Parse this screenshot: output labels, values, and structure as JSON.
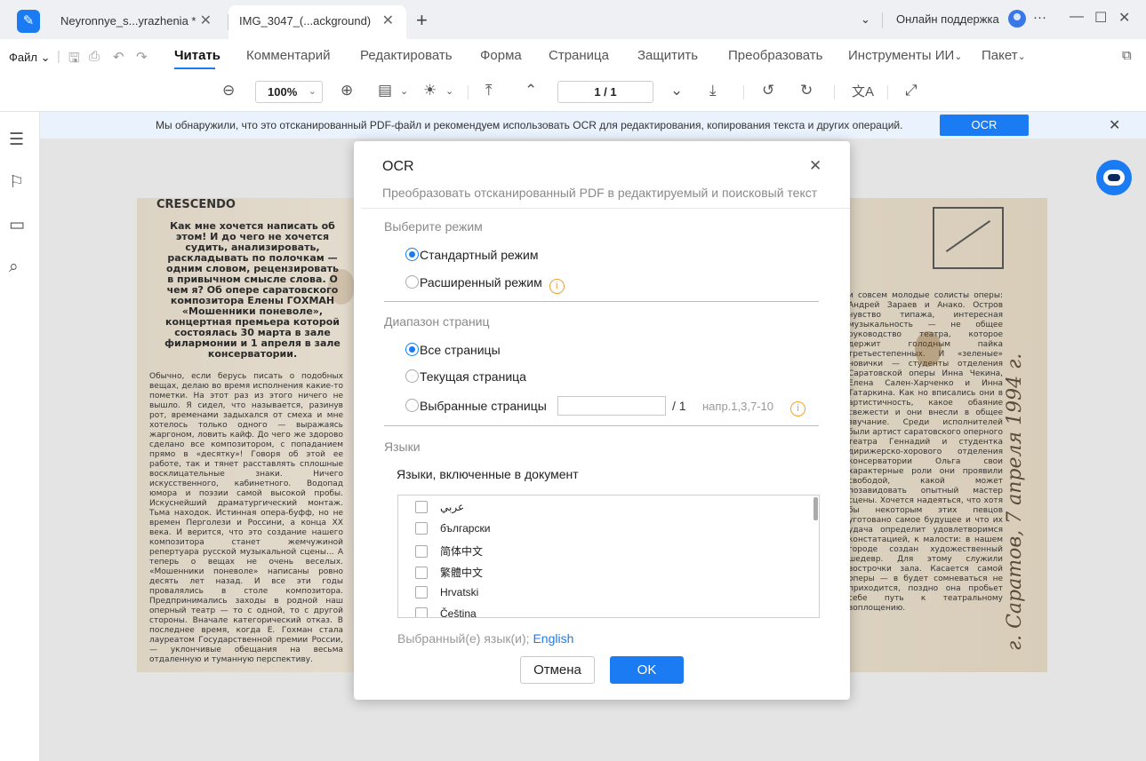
{
  "tabs": [
    {
      "label": "Neyronnye_s...yrazhenia *"
    },
    {
      "label": "IMG_3047_(...ackground)"
    }
  ],
  "titlebar": {
    "support": "Онлайн поддержка",
    "more": "···"
  },
  "menubar": {
    "file": "Файл",
    "items": [
      "Читать",
      "Комментарий",
      "Редактировать",
      "Форма",
      "Страница",
      "Защитить",
      "Преобразовать",
      "Инструменты ИИ",
      "Пакет"
    ],
    "active_index": 0
  },
  "toolbar": {
    "zoom": "100%",
    "page": "1 / 1"
  },
  "banner": {
    "text": "Мы обнаружили, что это отсканированный PDF-файл и рекомендуем использовать OCR для редактирования, копирования текста и других операций.",
    "button": "OCR"
  },
  "newspaper": {
    "header": "CRESCENDO",
    "lead": "Как мне хочется написать об этом! И до чего не хочется судить, анализировать, раскладывать по полочкам — одним словом, рецензировать в привычном смысле слова. О чем я? Об опере саратовского композитора Елены ГОХМАН «Мошенники поневоле», концертная премьера которой состоялась 30 марта в зале филармонии и 1 апреля в зале консерватории.",
    "body": "Обычно, если берусь писать о подобных вещах, делаю во время исполнения какие-то пометки. На этот раз из этого ничего не вышло. Я сидел, что называется, разинув рот, временами задыхался от смеха и мне хотелось только одного — выражаясь жаргоном, ловить кайф. До чего же здорово сделано все композитором, с попаданием прямо в «десятку»! Говоря об этой ее работе, так и тянет расставлять сплошные восклицательные знаки. Ничего искусственного, кабинетного. Водопад юмора и поэзии самой высокой пробы. Искуснейший драматургический монтаж. Тьма находок. Истинная опера-буфф, но не времен Перголези и Россини, а конца XX века. И верится, что это создание нашего композитора станет жемчужиной репертуара русской музыкальной сцены... А теперь о вещах не очень веселых. «Мошенники поневоле» написаны ровно десять лет назад. И все эти годы провалялись в столе композитора. Предпринимались заходы в родной наш оперный театр — то с одной, то с другой стороны. Вначале категорический отказ. В последнее время, когда Е. Гохман стала лауреатом Государственной премии России, — уклончивые обещания на весьма отдаленную и туманную перспективу.",
    "right": "и совсем молодые солисты оперы: Андрей Зараев и Анако. Остров чувство типажа, интересная музыкальность — не общее руководство театра, которое держит голодным пайка третьестепенных. И «зеленые» новички — студенты отделения Саратовской оперы Инна Чекина, Елена Сален-Харченко и Инна Татаркина. Как но вписались они в артистичность, какое обаяние свежести и они внесли в общее звучание. Среди исполнителей были артист саратовского оперного театра Геннадий и студентка дирижерско-хорового отделения консерватории Ольга свои характерные роли они проявили свободой, какой может позавидовать опытный мастер сцены. Хочется надеяться, что хотя бы некоторым этих певцов уготовано самое будущее и что их удача определит удовлетворимся констатацией, к малости: в нашем городе создан художественный шедевр. Для этому служили вострочки зала. Касается самой оперы — в будет сомневаться не приходится, поздно она пробьет себе путь к театральному воплощению.",
    "handwriting": "г. Саратов, 7 апреля 1994 г."
  },
  "ocr_dialog": {
    "title": "OCR",
    "subtitle": "Преобразовать отсканированный PDF в редактируемый и поисковый текст",
    "mode_section": "Выберите режим",
    "modes": [
      {
        "label": "Стандартный режим",
        "selected": true
      },
      {
        "label": "Расширенный режим",
        "selected": false
      }
    ],
    "range_section": "Диапазон страниц",
    "ranges": [
      {
        "label": "Все страницы",
        "selected": true
      },
      {
        "label": "Текущая страница",
        "selected": false
      },
      {
        "label": "Выбранные страницы",
        "selected": false
      }
    ],
    "pages_input": "",
    "pages_total": "/ 1",
    "pages_hint": "напр.1,3,7-10",
    "lang_section": "Языки",
    "lang_subtitle": "Языки, включенные в документ",
    "languages": [
      "عربي",
      "български",
      "简体中文",
      "繁體中文",
      "Hrvatski",
      "Čeština"
    ],
    "selected_label": "Выбранный(е) язык(и);",
    "selected_value": "English",
    "cancel": "Отмена",
    "ok": "OK"
  },
  "icons": {
    "info": "i",
    "close": "✕"
  },
  "colors": {
    "accent": "#1a7bf2",
    "banner_bg": "#e9f2fd",
    "info": "#f0a030"
  }
}
